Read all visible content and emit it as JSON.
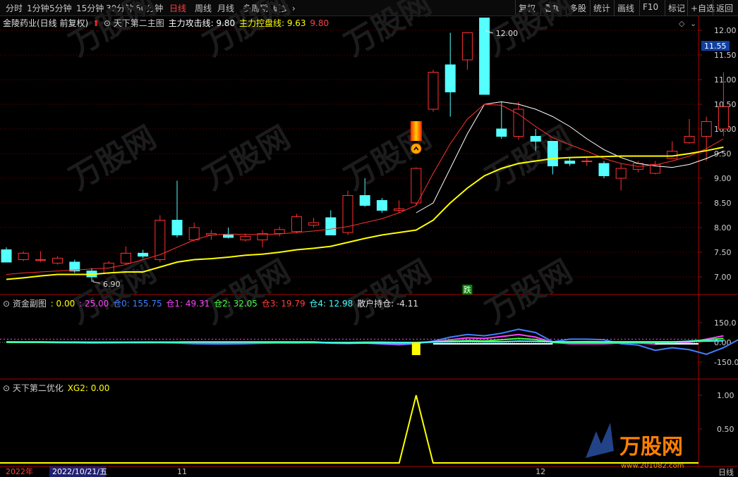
{
  "toolbar": {
    "periods": [
      "分时",
      "1分钟",
      "5分钟",
      "15分钟",
      "30分钟",
      "60分钟",
      "日线",
      "周线",
      "月线",
      "多周期",
      "更多 ›"
    ],
    "active_period": "日线",
    "right_buttons": [
      "复权",
      "叠加",
      "多股",
      "统计",
      "画线",
      "F10",
      "标记",
      "+自选",
      "返回"
    ]
  },
  "main_pane": {
    "stock_title": "金陵药业(日线 前复权)",
    "indicator_name": "天下第二主图",
    "attack_line_label": "主力攻击线:",
    "attack_line_value": "9.80",
    "control_line_label": "主力控盘线:",
    "control_line_value": "9.63",
    "extra_value": "9.80",
    "price_marker": "11.55",
    "high_label": "12.00",
    "low_label": "6.90",
    "signal_text": "跌",
    "y_ticks": [
      "12.00",
      "11.50",
      "11.00",
      "10.50",
      "10.00",
      "9.50",
      "9.00",
      "8.50",
      "8.00",
      "7.50",
      "7.00"
    ]
  },
  "fund_pane": {
    "name": "资金副图",
    "values": [
      {
        "label": ": 0.00",
        "color": "#ffff00"
      },
      {
        "label": ": 25.00",
        "color": "#ff40ff"
      },
      {
        "label": "仓0: 155.75",
        "color": "#4080ff"
      },
      {
        "label": "仓1: 49.31",
        "color": "#ff40ff"
      },
      {
        "label": "仓2: 32.05",
        "color": "#40ff40"
      },
      {
        "label": "仓3: 19.79",
        "color": "#ff4040"
      },
      {
        "label": "仓4: 12.98",
        "color": "#40ffff"
      },
      {
        "label": "散户持仓: -4.11",
        "color": "#e0e0e0"
      }
    ],
    "y_ticks": [
      "150.0",
      "0.00",
      "-150.0"
    ]
  },
  "opt_pane": {
    "name": "天下第二优化",
    "xg2_label": "XG2: 0.00",
    "y_ticks": [
      "1.00",
      "0.50"
    ]
  },
  "x_axis": {
    "year_label": "2022年",
    "cursor_date": "2022/10/21/五",
    "month_labels": [
      "11",
      "12"
    ]
  },
  "status_label": "日线",
  "watermark": {
    "brand": "万股网",
    "url": "www.201082.com"
  },
  "colors": {
    "up": "#ff3030",
    "down": "#54ffff",
    "ma_fast": "#ff3030",
    "ma_slow": "#ffff00",
    "ma_white": "#ffffff",
    "grid": "#7a0000"
  },
  "chart_data": {
    "type": "candlestick",
    "ylim": [
      6.75,
      12.25
    ],
    "candles": [
      [
        7.55,
        7.3,
        7.6,
        7.3
      ],
      [
        7.35,
        7.48,
        7.52,
        7.32
      ],
      [
        7.35,
        7.35,
        7.52,
        7.3
      ],
      [
        7.28,
        7.38,
        7.42,
        7.25
      ],
      [
        7.3,
        7.12,
        7.35,
        7.08
      ],
      [
        7.12,
        7.0,
        7.18,
        6.9
      ],
      [
        7.08,
        7.28,
        7.32,
        7.05
      ],
      [
        7.28,
        7.48,
        7.62,
        7.25
      ],
      [
        7.48,
        7.42,
        7.55,
        7.38
      ],
      [
        7.35,
        8.15,
        8.25,
        7.3
      ],
      [
        8.15,
        7.85,
        8.95,
        7.8
      ],
      [
        7.75,
        8.0,
        8.1,
        7.72
      ],
      [
        7.85,
        7.88,
        7.95,
        7.75
      ],
      [
        7.85,
        7.8,
        8.0,
        7.78
      ],
      [
        7.75,
        7.82,
        7.88,
        7.72
      ],
      [
        7.75,
        7.88,
        7.95,
        7.6
      ],
      [
        7.88,
        7.96,
        8.02,
        7.82
      ],
      [
        7.92,
        8.22,
        8.28,
        7.88
      ],
      [
        8.05,
        8.1,
        8.2,
        8.0
      ],
      [
        8.2,
        7.85,
        8.35,
        7.85
      ],
      [
        7.9,
        8.65,
        8.75,
        7.85
      ],
      [
        8.65,
        8.45,
        9.0,
        8.42
      ],
      [
        8.55,
        8.35,
        8.6,
        8.3
      ],
      [
        8.35,
        8.38,
        8.55,
        8.3
      ],
      [
        8.5,
        9.2,
        9.22,
        8.45
      ],
      [
        10.4,
        11.15,
        11.2,
        10.35
      ],
      [
        11.3,
        10.75,
        11.95,
        10.25
      ],
      [
        11.4,
        11.95,
        11.95,
        11.2
      ],
      [
        12.25,
        10.7,
        12.25,
        10.7
      ],
      [
        10.0,
        9.85,
        10.55,
        9.8
      ],
      [
        9.85,
        10.4,
        10.55,
        9.78
      ],
      [
        9.85,
        9.75,
        10.0,
        9.55
      ],
      [
        9.75,
        9.25,
        9.65,
        9.08
      ],
      [
        9.35,
        9.3,
        9.42,
        9.25
      ],
      [
        9.35,
        9.35,
        9.42,
        9.25
      ],
      [
        9.3,
        9.05,
        9.35,
        9.0
      ],
      [
        9.0,
        9.2,
        9.3,
        8.75
      ],
      [
        9.18,
        9.3,
        9.35,
        9.12
      ],
      [
        9.1,
        9.28,
        9.35,
        9.08
      ],
      [
        9.4,
        9.55,
        9.75,
        9.4
      ],
      [
        9.72,
        9.85,
        10.2,
        9.7
      ],
      [
        9.85,
        10.15,
        10.25,
        9.35
      ],
      [
        10.0,
        10.45,
        11.15,
        9.85
      ]
    ],
    "ma_slow": [
      6.95,
      6.98,
      7.02,
      7.05,
      7.05,
      7.05,
      7.08,
      7.1,
      7.1,
      7.2,
      7.3,
      7.35,
      7.37,
      7.4,
      7.44,
      7.46,
      7.5,
      7.55,
      7.58,
      7.62,
      7.7,
      7.78,
      7.85,
      7.9,
      7.95,
      8.15,
      8.5,
      8.8,
      9.05,
      9.2,
      9.3,
      9.35,
      9.4,
      9.42,
      9.43,
      9.44,
      9.45,
      9.45,
      9.45,
      9.45,
      9.5,
      9.56,
      9.63
    ],
    "ma_fast": [
      7.05,
      7.08,
      7.1,
      7.12,
      7.14,
      7.16,
      7.18,
      7.25,
      7.35,
      7.45,
      7.6,
      7.75,
      7.85,
      7.87,
      7.86,
      7.86,
      7.87,
      7.9,
      7.93,
      7.97,
      8.02,
      8.1,
      8.18,
      8.3,
      8.45,
      9.1,
      9.7,
      10.2,
      10.5,
      10.48,
      10.3,
      10.05,
      9.82,
      9.68,
      9.55,
      9.4,
      9.3,
      9.24,
      9.27,
      9.35,
      9.45,
      9.6,
      9.8
    ],
    "ma_white_start": 24,
    "ma_white": [
      8.3,
      8.5,
      9.2,
      9.9,
      10.5,
      10.55,
      10.5,
      10.4,
      10.25,
      10.05,
      9.8,
      9.58,
      9.42,
      9.3,
      9.25,
      9.22,
      9.28,
      9.4,
      9.55
    ],
    "fund_series": [
      {
        "name": "仓0",
        "color": "#4080ff",
        "values": [
          2,
          0,
          0,
          -2,
          -3,
          -5,
          -4,
          -3,
          -3,
          -3,
          -5,
          -10,
          -12,
          -12,
          -10,
          -6,
          -4,
          -5,
          -3,
          -6,
          -8,
          -5,
          -12,
          -18,
          -10,
          10,
          40,
          60,
          50,
          70,
          100,
          75,
          5,
          25,
          25,
          20,
          -10,
          -20,
          -60,
          -40,
          -55,
          -90,
          -40,
          30
        ]
      },
      {
        "name": "仓1",
        "color": "#ff40ff",
        "values": [
          0,
          0,
          0,
          0,
          -2,
          -2,
          -2,
          -2,
          -2,
          0,
          0,
          0,
          -3,
          -3,
          -2,
          -2,
          -2,
          -2,
          -2,
          -3,
          -3,
          -5,
          -8,
          -10,
          -5,
          5,
          20,
          35,
          30,
          45,
          60,
          40,
          0,
          -10,
          -10,
          -10,
          -5,
          -5,
          -12,
          -10,
          0,
          25,
          50
        ]
      },
      {
        "name": "仓2",
        "color": "#40ff40",
        "values": [
          0,
          0,
          0,
          0,
          0,
          0,
          0,
          0,
          0,
          0,
          0,
          2,
          2,
          2,
          2,
          0,
          0,
          0,
          0,
          0,
          0,
          2,
          2,
          0,
          0,
          5,
          10,
          15,
          12,
          20,
          30,
          22,
          0,
          0,
          0,
          0,
          -2,
          0,
          0,
          0,
          10,
          20,
          30
        ]
      },
      {
        "name": "仓4",
        "color": "#40ffff",
        "values": [
          5,
          4,
          4,
          3,
          3,
          2,
          2,
          2,
          3,
          3,
          3,
          4,
          4,
          4,
          4,
          4,
          4,
          4,
          4,
          -3,
          -5,
          -4,
          -3,
          -2,
          -2,
          3,
          5,
          8,
          5,
          5,
          10,
          8,
          5,
          5,
          6,
          5,
          5,
          5,
          5,
          5,
          8,
          10,
          13
        ]
      }
    ],
    "fund_ylim": [
      -250,
      250
    ],
    "xg2": {
      "peak_index": 24,
      "value": 1.0
    },
    "xg2_ylim": [
      0,
      1.2
    ]
  }
}
